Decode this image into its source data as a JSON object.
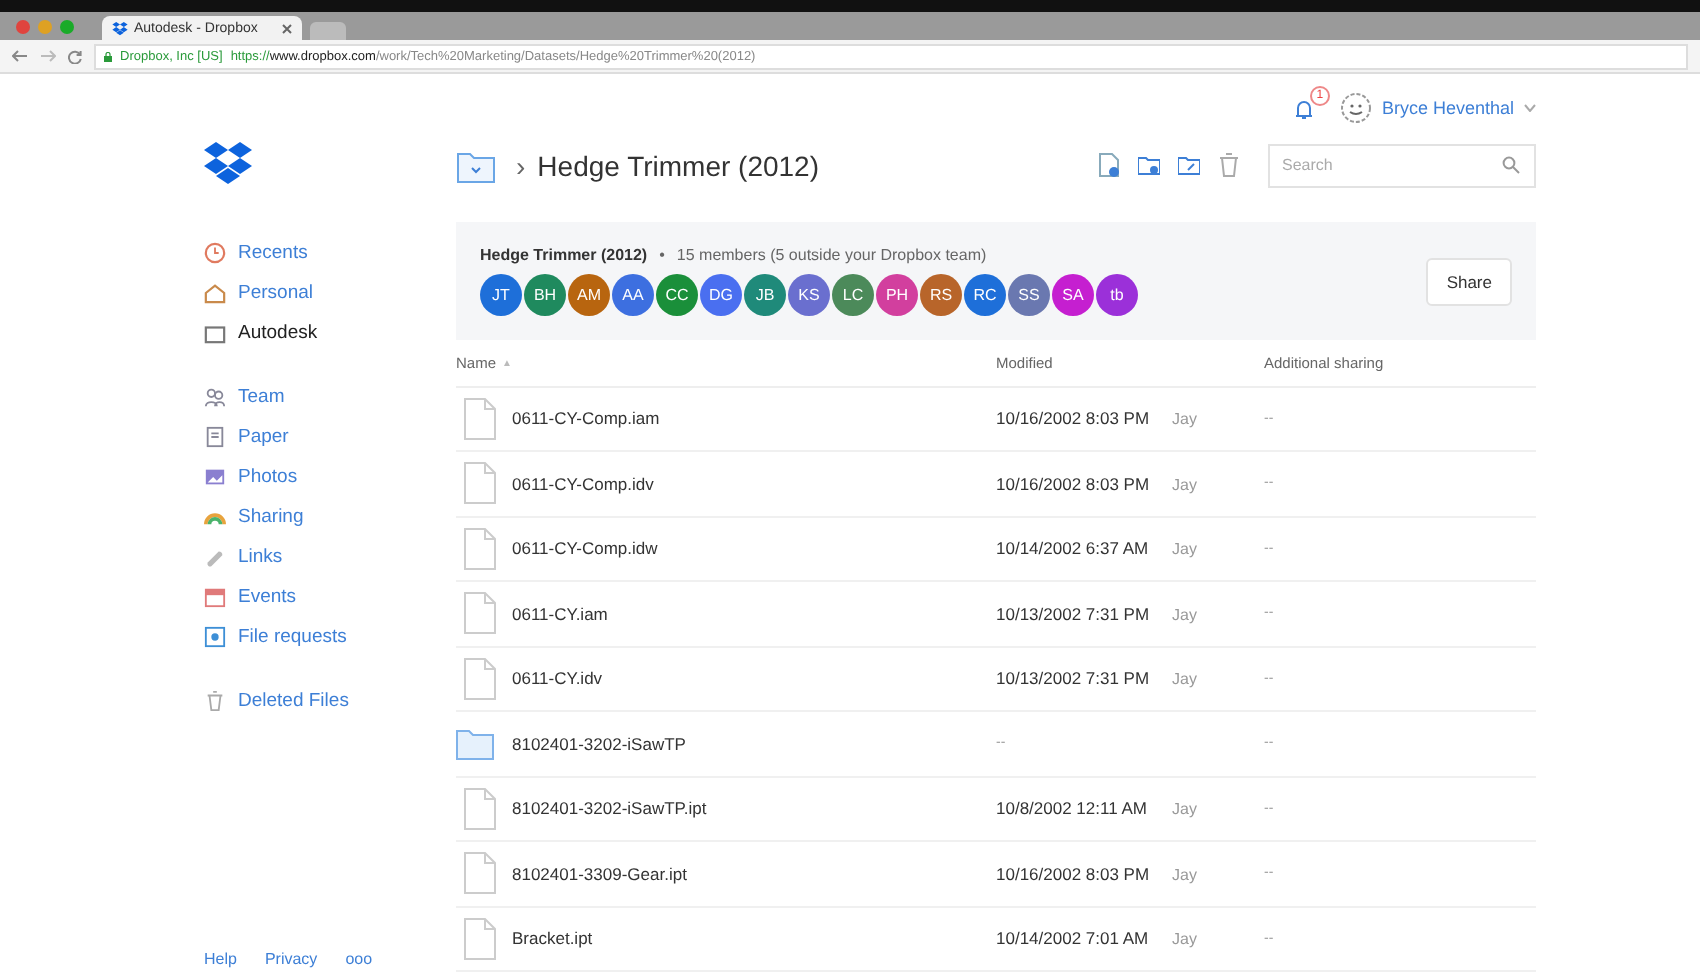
{
  "browser": {
    "tab_title": "Autodesk - Dropbox",
    "site_identity": "Dropbox, Inc [US]",
    "url_scheme": "https://",
    "url_host": "www.dropbox.com",
    "url_path": "/work/Tech%20Marketing/Datasets/Hedge%20Trimmer%20(2012)"
  },
  "sidebar": {
    "groups": [
      [
        {
          "label": "Recents",
          "selected": false
        },
        {
          "label": "Personal",
          "selected": false
        },
        {
          "label": "Autodesk",
          "selected": true
        }
      ],
      [
        {
          "label": "Team",
          "selected": false
        },
        {
          "label": "Paper",
          "selected": false
        },
        {
          "label": "Photos",
          "selected": false
        },
        {
          "label": "Sharing",
          "selected": false
        },
        {
          "label": "Links",
          "selected": false
        },
        {
          "label": "Events",
          "selected": false
        },
        {
          "label": "File requests",
          "selected": false
        }
      ],
      [
        {
          "label": "Deleted Files",
          "selected": false
        }
      ]
    ],
    "footer": [
      "Help",
      "Privacy",
      "ooo"
    ]
  },
  "top_bar": {
    "notification_count": "1",
    "user_name": "Bryce Heventhal"
  },
  "header": {
    "breadcrumb_separator": "›",
    "title": "Hedge Trimmer (2012)",
    "search": {
      "placeholder": "Search"
    }
  },
  "members_panel": {
    "folder_name": "Hedge Trimmer (2012)",
    "separator": "•",
    "summary": "15 members (5 outside your Dropbox team)",
    "share_button": "Share",
    "members": [
      {
        "initials": "JT",
        "color": "#1e6fd9"
      },
      {
        "initials": "BH",
        "color": "#1f8a5e"
      },
      {
        "initials": "AM",
        "color": "#b8650f"
      },
      {
        "initials": "AA",
        "color": "#3d6fe0"
      },
      {
        "initials": "CC",
        "color": "#1a8f3a"
      },
      {
        "initials": "DG",
        "color": "#4a6ff0"
      },
      {
        "initials": "JB",
        "color": "#1f8a7a"
      },
      {
        "initials": "KS",
        "color": "#6a6fcf"
      },
      {
        "initials": "LC",
        "color": "#4c8a5a"
      },
      {
        "initials": "PH",
        "color": "#d23f9e"
      },
      {
        "initials": "RS",
        "color": "#b8652a"
      },
      {
        "initials": "RC",
        "color": "#1e6fd9"
      },
      {
        "initials": "SS",
        "color": "#6a78b0"
      },
      {
        "initials": "SA",
        "color": "#c51fd0"
      },
      {
        "initials": "tb",
        "color": "#9b30d9"
      }
    ]
  },
  "table": {
    "columns": [
      "Name",
      "Modified",
      "Additional sharing"
    ],
    "sort_indicator": "▲",
    "rows": [
      {
        "kind": "file",
        "name": "0611-CY-Comp.iam",
        "modified": "10/16/2002 8:03 PM",
        "modified_by": "Jay",
        "sharing": "--"
      },
      {
        "kind": "file",
        "name": "0611-CY-Comp.idv",
        "modified": "10/16/2002 8:03 PM",
        "modified_by": "Jay",
        "sharing": "--"
      },
      {
        "kind": "file",
        "name": "0611-CY-Comp.idw",
        "modified": "10/14/2002 6:37 AM",
        "modified_by": "Jay",
        "sharing": "--"
      },
      {
        "kind": "file",
        "name": "0611-CY.iam",
        "modified": "10/13/2002 7:31 PM",
        "modified_by": "Jay",
        "sharing": "--"
      },
      {
        "kind": "file",
        "name": "0611-CY.idv",
        "modified": "10/13/2002 7:31 PM",
        "modified_by": "Jay",
        "sharing": "--"
      },
      {
        "kind": "folder",
        "name": "8102401-3202-iSawTP",
        "modified": "--",
        "sharing": "--"
      },
      {
        "kind": "file",
        "name": "8102401-3202-iSawTP.ipt",
        "modified": "10/8/2002 12:11 AM",
        "modified_by": "Jay",
        "sharing": "--"
      },
      {
        "kind": "file",
        "name": "8102401-3309-Gear.ipt",
        "modified": "10/16/2002 8:03 PM",
        "modified_by": "Jay",
        "sharing": "--"
      },
      {
        "kind": "file",
        "name": "Bracket.ipt",
        "modified": "10/14/2002 7:01 AM",
        "modified_by": "Jay",
        "sharing": "--"
      }
    ]
  }
}
